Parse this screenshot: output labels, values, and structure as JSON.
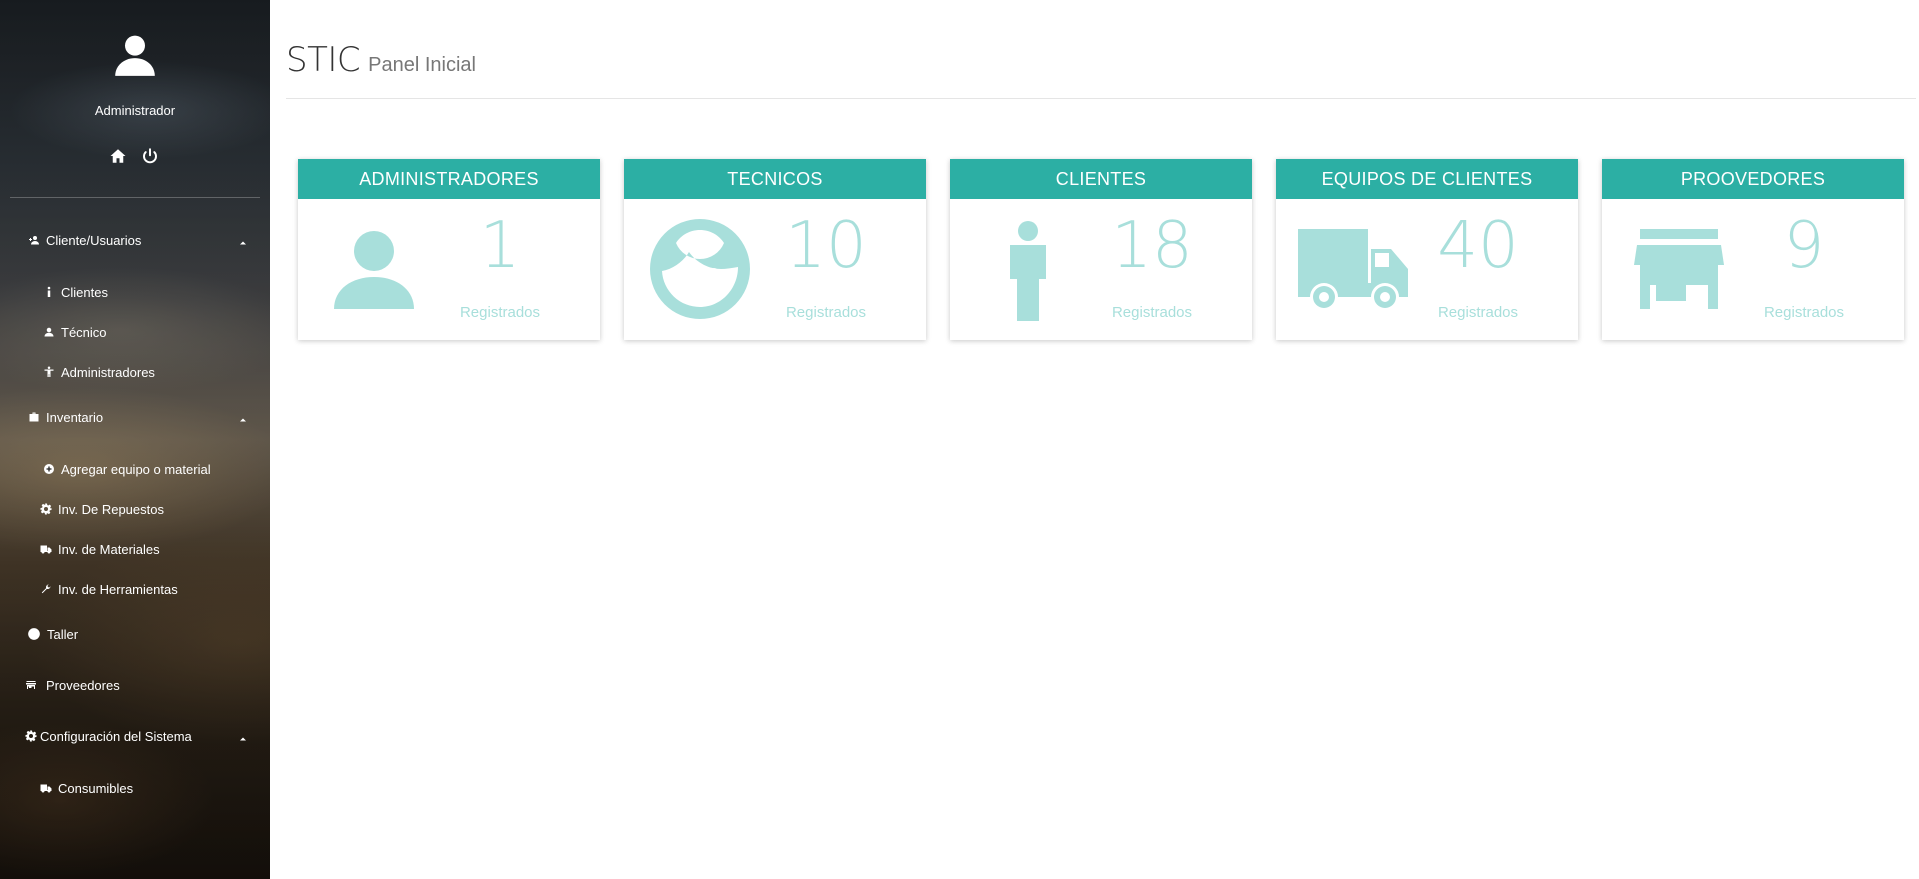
{
  "sidebar": {
    "user_name": "Administrador",
    "items": [
      {
        "label": "Cliente/Usuarios",
        "icon": "user-plus-icon"
      },
      {
        "label": "Clientes",
        "icon": "info-icon"
      },
      {
        "label": "Técnico",
        "icon": "person-icon"
      },
      {
        "label": "Administradores",
        "icon": "accessibility-icon"
      },
      {
        "label": "Inventario",
        "icon": "briefcase-icon"
      },
      {
        "label": "Agregar equipo o material",
        "icon": "plus-circle-icon"
      },
      {
        "label": "Inv. De Repuestos",
        "icon": "gear-icon"
      },
      {
        "label": "Inv. de Materiales",
        "icon": "truck-icon"
      },
      {
        "label": "Inv. de Herramientas",
        "icon": "wrench-icon"
      },
      {
        "label": "Taller",
        "icon": "cog-outline-icon"
      },
      {
        "label": "Proveedores",
        "icon": "store-icon"
      },
      {
        "label": "Configuración del Sistema",
        "icon": "gear-icon"
      },
      {
        "label": "Consumibles",
        "icon": "truck-icon"
      }
    ]
  },
  "header": {
    "title": "STIC",
    "subtitle": "Panel Inicial"
  },
  "cards": [
    {
      "title": "ADMINISTRADORES",
      "count": "1",
      "label": "Registrados",
      "icon": "person-icon"
    },
    {
      "title": "TECNICOS",
      "count": "10",
      "label": "Registrados",
      "icon": "face-icon"
    },
    {
      "title": "CLIENTES",
      "count": "18",
      "label": "Registrados",
      "icon": "standing-person-icon"
    },
    {
      "title": "EQUIPOS DE CLIENTES",
      "count": "40",
      "label": "Registrados",
      "icon": "truck-icon"
    },
    {
      "title": "PROOVEDORES",
      "count": "9",
      "label": "Registrados",
      "icon": "store-icon"
    }
  ],
  "colors": {
    "accent": "#2cafa4",
    "icon_light": "#a8dfdb"
  }
}
